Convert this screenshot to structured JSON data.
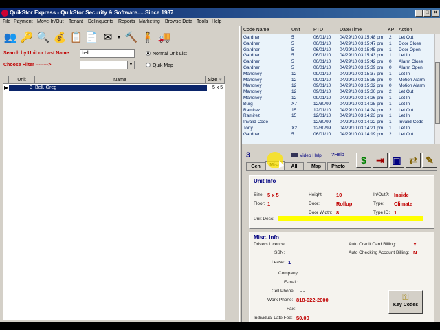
{
  "window": {
    "title": "QuikStor Express - QuikStor Security & Software.....Since 1987"
  },
  "menu": [
    "File",
    "Payment",
    "Move-In/Out",
    "Tenant",
    "Delinquents",
    "Reports",
    "Marketing",
    "Browse Data",
    "Tools",
    "Help"
  ],
  "toolbar_icons": [
    "people-icon",
    "key-icon",
    "search-document-icon",
    "money-bag-icon",
    "notepad-icon",
    "document-icon",
    "mail-icon",
    "cake-icon",
    "gavel-icon",
    "person-icon",
    "truck-icon"
  ],
  "search": {
    "label": "Search by Unit or Last Name",
    "value": "bell",
    "filter_label": "Choose Filter   -------->",
    "filter_value": "",
    "radio_normal": "Normal Unit List",
    "radio_map": "Quik Map"
  },
  "unit_table": {
    "columns": [
      "Unit",
      "Name",
      "Size"
    ],
    "rows": [
      {
        "unit": "3",
        "name": "Bell, Greg",
        "size": "5 x 5"
      }
    ]
  },
  "access_log": {
    "columns": [
      "Code Name",
      "Unit",
      "PTD",
      "Date/Time",
      "KP",
      "Action"
    ],
    "rows": [
      {
        "code": "Gardner",
        "unit": "5",
        "ptd": "06/01/10",
        "dt": "04/29/10 03:15:48 pm",
        "kp": "2",
        "action": "Let Out"
      },
      {
        "code": "Gardner",
        "unit": "5",
        "ptd": "06/01/10",
        "dt": "04/29/10 03:15:47 pm",
        "kp": "1",
        "action": "Door Close"
      },
      {
        "code": "Gardner",
        "unit": "5",
        "ptd": "06/01/10",
        "dt": "04/29/10 03:15:45 pm",
        "kp": "1",
        "action": "Door Open"
      },
      {
        "code": "Gardner",
        "unit": "5",
        "ptd": "06/01/10",
        "dt": "04/29/10 03:15:43 pm",
        "kp": "1",
        "action": "Let In"
      },
      {
        "code": "Gardner",
        "unit": "5",
        "ptd": "06/01/10",
        "dt": "04/29/10 03:15:42 pm",
        "kp": "0",
        "action": "Alarm Close"
      },
      {
        "code": "Gardner",
        "unit": "5",
        "ptd": "06/01/10",
        "dt": "04/29/10 03:15:39 pm",
        "kp": "0",
        "action": "Alarm Open"
      },
      {
        "code": "Mahoney",
        "unit": "12",
        "ptd": "09/01/10",
        "dt": "04/29/10 03:15:37 pm",
        "kp": "1",
        "action": "Let In"
      },
      {
        "code": "Mahoney",
        "unit": "12",
        "ptd": "09/01/10",
        "dt": "04/29/10 03:15:35 pm",
        "kp": "0",
        "action": "Motion Alarm"
      },
      {
        "code": "Mahoney",
        "unit": "12",
        "ptd": "09/01/10",
        "dt": "04/29/10 03:15:32 pm",
        "kp": "0",
        "action": "Motion Alarm"
      },
      {
        "code": "Mahoney",
        "unit": "12",
        "ptd": "09/01/10",
        "dt": "04/29/10 03:15:30 pm",
        "kp": "2",
        "action": "Let Out"
      },
      {
        "code": "Mahoney",
        "unit": "12",
        "ptd": "09/01/10",
        "dt": "04/29/10 03:14:26 pm",
        "kp": "1",
        "action": "Let In"
      },
      {
        "code": "Burg",
        "unit": "X7",
        "ptd": "12/30/99",
        "dt": "04/29/10 03:14:25 pm",
        "kp": "1",
        "action": "Let In"
      },
      {
        "code": "Ramirez",
        "unit": "15",
        "ptd": "12/01/10",
        "dt": "04/29/10 03:14:24 pm",
        "kp": "2",
        "action": "Let Out"
      },
      {
        "code": "Ramirez",
        "unit": "15",
        "ptd": "12/01/10",
        "dt": "04/29/10 03:14:23 pm",
        "kp": "1",
        "action": "Let In"
      },
      {
        "code": "Invalid Code",
        "unit": "",
        "ptd": "12/30/99",
        "dt": "04/29/10 03:14:22 pm",
        "kp": "1",
        "action": "Invalid Code"
      },
      {
        "code": "Tony",
        "unit": "X2",
        "ptd": "12/30/99",
        "dt": "04/29/10 03:14:21 pm",
        "kp": "1",
        "action": "Let In"
      },
      {
        "code": "Gardner",
        "unit": "5",
        "ptd": "06/01/10",
        "dt": "04/29/10 03:14:19 pm",
        "kp": "2",
        "action": "Let Out"
      }
    ]
  },
  "detail": {
    "unit_number": "3",
    "video_help": "Video Help",
    "help": "Help",
    "tabs": [
      "Gen",
      "Misc",
      "All",
      "Map",
      "Photo"
    ],
    "active_tab": "Misc",
    "unit_info": {
      "title": "Unit Info",
      "size_label": "Size:",
      "size": "5 x 5",
      "floor_label": "Floor:",
      "floor": "1",
      "height_label": "Height:",
      "height": "10",
      "door_label": "Door:",
      "door": "Rollup",
      "door_width_label": "Door Width:",
      "door_width": "8",
      "inout_label": "In/Out?:",
      "inout": "Inside",
      "type_label": "Type:",
      "type": "Climate",
      "typeid_label": "Type ID:",
      "typeid": "1",
      "desc_label": "Unit Desc:"
    },
    "misc_info": {
      "title": "Misc. Info",
      "drivers_label": "Drivers Licence:",
      "ssn_label": "SSN:",
      "lease_label": "Lease:",
      "lease": "1",
      "auto_cc_label": "Auto Credit Card Billing:",
      "auto_cc": "Y",
      "auto_check_label": "Auto Checking Account Billing:",
      "auto_check": "N",
      "company_label": "Company:",
      "email_label": "E-mail:",
      "cell_label": "Cell Phone:",
      "cell": "-   -",
      "work_label": "Work Phone:",
      "work": "818-922-2000",
      "fax_label": "Fax:",
      "fax": "-   -",
      "late_fee_label": "Individual Late Fee:",
      "late_fee": "$0.00",
      "key_codes": "Key Codes"
    }
  },
  "colors": {
    "title_bar": "#0a246a",
    "label_red": "#c00000",
    "selection": "#0a246a",
    "heading_blue": "#000080"
  }
}
